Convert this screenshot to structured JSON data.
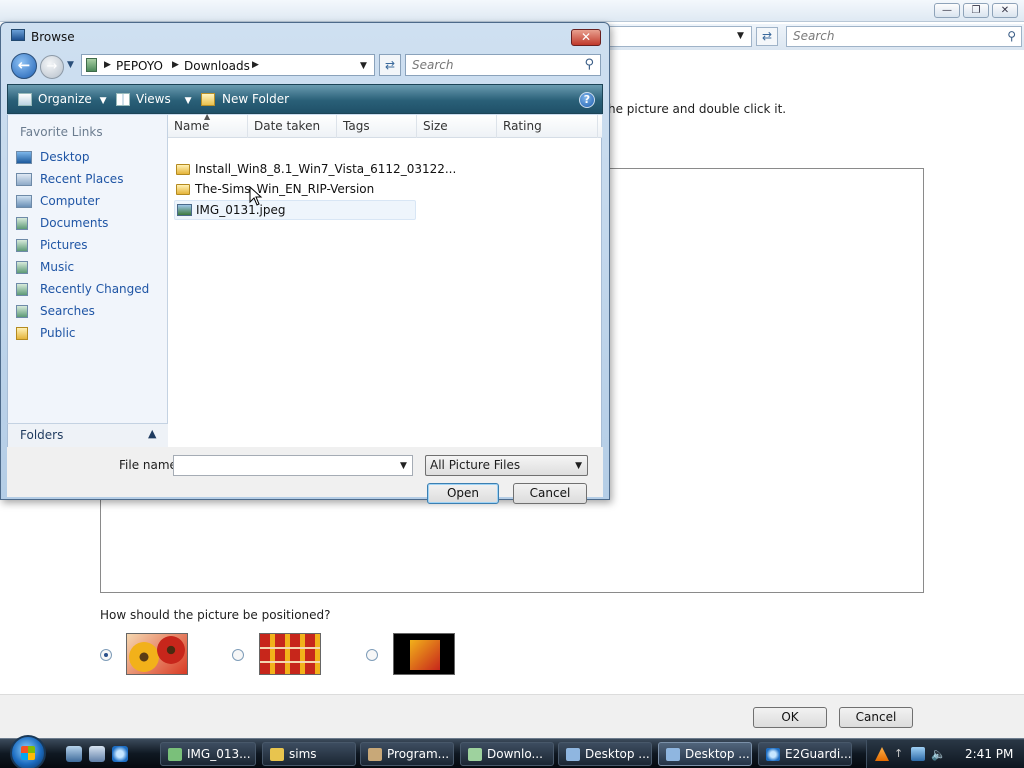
{
  "background_window": {
    "search_placeholder": "Search",
    "instruction_text": "he picture and double click it.",
    "position_question": "How should the picture be positioned?",
    "position_options": [
      "fit",
      "tile",
      "center"
    ],
    "selected_position": 0,
    "ok_label": "OK",
    "cancel_label": "Cancel"
  },
  "dialog": {
    "title": "Browse",
    "breadcrumbs": [
      "PEPOYO",
      "Downloads"
    ],
    "search_placeholder": "Search",
    "toolbar": {
      "organize": "Organize",
      "views": "Views",
      "new_folder": "New Folder",
      "help": "?"
    },
    "favorite_links_title": "Favorite Links",
    "favorites": [
      {
        "label": "Desktop",
        "icon": "desktop-icon"
      },
      {
        "label": "Recent Places",
        "icon": "recent-places-icon"
      },
      {
        "label": "Computer",
        "icon": "computer-icon"
      },
      {
        "label": "Documents",
        "icon": "documents-icon"
      },
      {
        "label": "Pictures",
        "icon": "pictures-icon"
      },
      {
        "label": "Music",
        "icon": "music-icon"
      },
      {
        "label": "Recently Changed",
        "icon": "recently-changed-icon"
      },
      {
        "label": "Searches",
        "icon": "searches-icon"
      },
      {
        "label": "Public",
        "icon": "public-folder-icon"
      }
    ],
    "folders_label": "Folders",
    "columns": [
      "Name",
      "Date taken",
      "Tags",
      "Size",
      "Rating"
    ],
    "files": [
      {
        "name": "Install_Win8_8.1_Win7_Vista_6112_03122...",
        "type": "folder"
      },
      {
        "name": "The-Sims_Win_EN_RIP-Version",
        "type": "folder"
      },
      {
        "name": "IMG_0131.jpeg",
        "type": "image"
      }
    ],
    "file_name_label": "File name:",
    "file_name_value": "",
    "filter_value": "All Picture Files",
    "open_label": "Open",
    "cancel_label": "Cancel"
  },
  "taskbar": {
    "tasks": [
      {
        "label": "IMG_013...",
        "icon": "image-file-icon",
        "active": false
      },
      {
        "label": "sims",
        "icon": "folder-icon",
        "active": false
      },
      {
        "label": "Program...",
        "icon": "program-icon",
        "active": false
      },
      {
        "label": "Downlo...",
        "icon": "downloads-folder-icon",
        "active": false
      },
      {
        "label": "Desktop ...",
        "icon": "display-icon",
        "active": false
      },
      {
        "label": "Desktop ...",
        "icon": "display-icon",
        "active": true
      },
      {
        "label": "E2Guardi...",
        "icon": "ie-icon",
        "active": false
      }
    ],
    "clock": "2:41 PM"
  }
}
